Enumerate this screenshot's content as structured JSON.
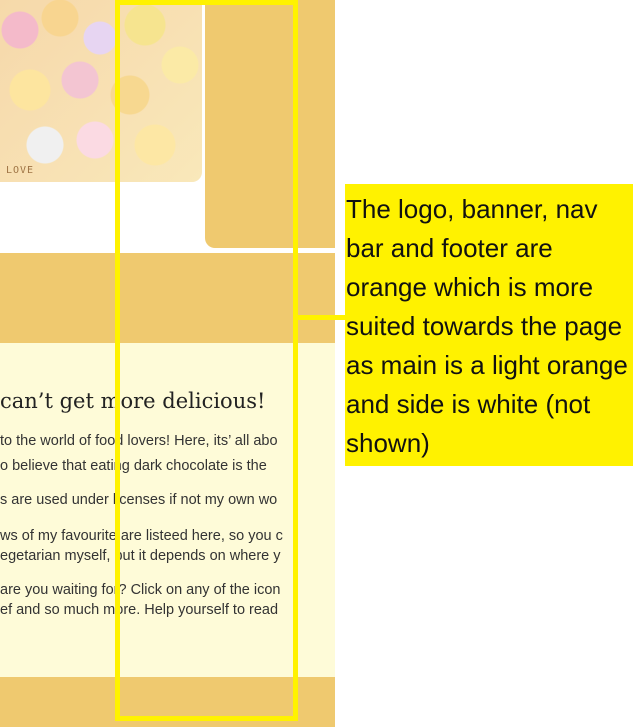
{
  "hero": {
    "alt_text": "LOVE"
  },
  "main": {
    "heading": "can’t get more delicious!",
    "paragraphs": [
      " to the world of food lovers! Here, its’ all abo",
      "o believe that eating dark chocolate is the",
      "s are used under licenses if not my own wo",
      "ws of my favourite are listeed here, so you c",
      "egetarian myself, but it depends on where y",
      "are you waiting for? Click on any of the icon",
      "ef and so much more. Help yourself to read"
    ]
  },
  "annotation": {
    "note": "The logo, banner, nav bar and footer are orange which is more suited towards the page as main is a light orange and side is white (not shown)"
  },
  "colors": {
    "orange": "#efc96f",
    "light_orange": "#fefbd8",
    "annotation_yellow": "#fff200"
  }
}
